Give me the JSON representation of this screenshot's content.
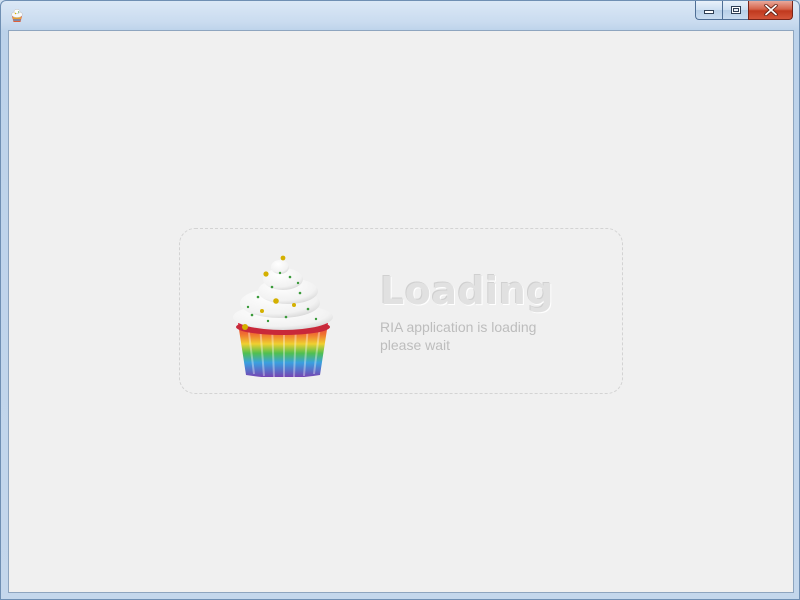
{
  "window": {
    "controls": {
      "minimize_icon": "minimize-icon",
      "maximize_icon": "maximize-icon",
      "close_icon": "close-icon"
    },
    "app_icon": "cupcake-icon"
  },
  "loader": {
    "title": "Loading",
    "line1": "RIA application is loading",
    "line2": "please wait",
    "image": "cupcake-image"
  },
  "colors": {
    "client_background": "#f0f0f0",
    "close_button": "#c94a30",
    "title_text": "#e1e1e1",
    "subtitle_text": "#bdbdbd"
  }
}
